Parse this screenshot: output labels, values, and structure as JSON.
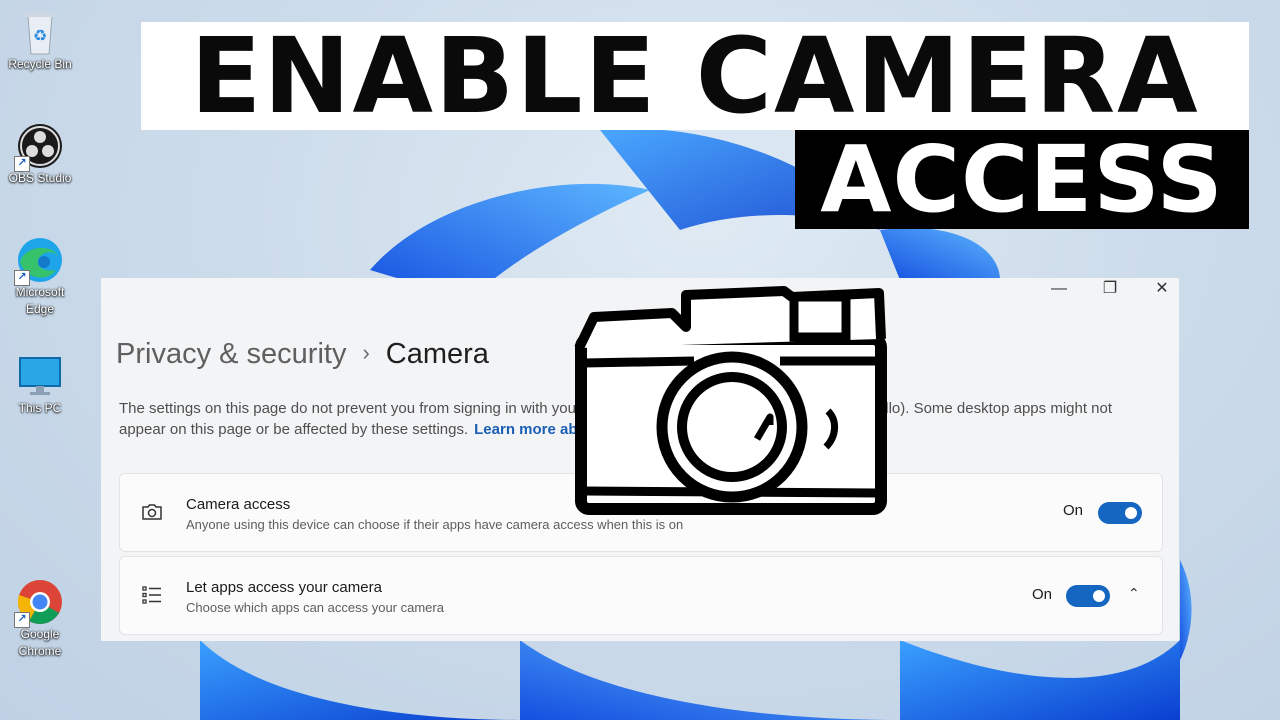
{
  "banner": {
    "line1": "ENABLE CAMERA",
    "line2": "ACCESS"
  },
  "desktop": {
    "icons": [
      {
        "label": "Recycle Bin",
        "icon": "recycle-bin-icon"
      },
      {
        "label": "OBS Studio",
        "icon": "obs-icon"
      },
      {
        "label": "Microsoft\nEdge",
        "icon": "edge-icon"
      },
      {
        "label": "This PC",
        "icon": "monitor-icon"
      },
      {
        "label": "Google\nChrome",
        "icon": "chrome-icon"
      }
    ]
  },
  "window": {
    "controls": {
      "minimize": "—",
      "restore": "❐",
      "close": "✕"
    },
    "breadcrumb": {
      "parent": "Privacy & security",
      "separator": "›",
      "current": "Camera"
    },
    "description": "The settings on this page do not prevent you from signing in with your camera using facial recognition (Windows Hello). Some desktop apps might not appear on this page or be affected by these settings.",
    "link": "Learn more about camera",
    "settings": [
      {
        "title": "Camera access",
        "subtitle": "Anyone using this device can choose if their apps have camera access when this is on",
        "state": "On",
        "toggle_on": true,
        "icon": "camera-icon"
      },
      {
        "title": "Let apps access your camera",
        "subtitle": "Choose which apps can access your camera",
        "state": "On",
        "toggle_on": true,
        "icon": "list-icon",
        "expand": "⌃"
      }
    ]
  },
  "colors": {
    "accent": "#1566c0",
    "link": "#1a5fb4",
    "banner_dark": "#000000"
  }
}
